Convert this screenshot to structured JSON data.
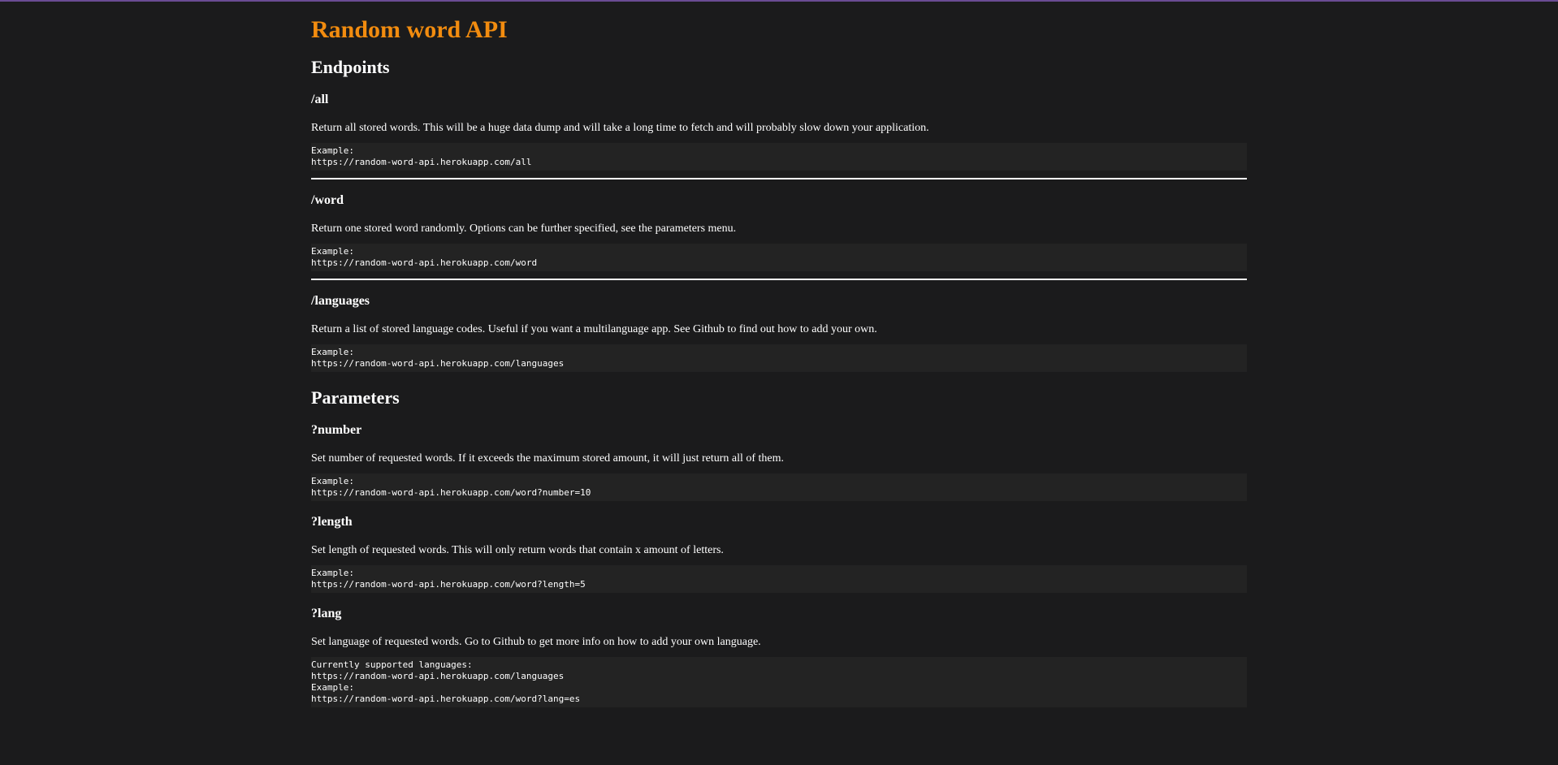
{
  "page": {
    "title": "Random word API"
  },
  "endpoints": {
    "heading": "Endpoints",
    "items": [
      {
        "name": "/all",
        "description": "Return all stored words. This will be a huge data dump and will take a long time to fetch and will probably slow down your application.",
        "example_label": "Example:",
        "example_url": "https://random-word-api.herokuapp.com/all"
      },
      {
        "name": "/word",
        "description": "Return one stored word randomly. Options can be further specified, see the parameters menu.",
        "example_label": "Example:",
        "example_url": "https://random-word-api.herokuapp.com/word"
      },
      {
        "name": "/languages",
        "description": "Return a list of stored language codes. Useful if you want a multilanguage app. See Github to find out how to add your own.",
        "example_label": "Example:",
        "example_url": "https://random-word-api.herokuapp.com/languages"
      }
    ]
  },
  "parameters": {
    "heading": "Parameters",
    "items": [
      {
        "name": "?number",
        "description": "Set number of requested words. If it exceeds the maximum stored amount, it will just return all of them.",
        "example_label": "Example:",
        "example_url": "https://random-word-api.herokuapp.com/word?number=10"
      },
      {
        "name": "?length",
        "description": "Set length of requested words. This will only return words that contain x amount of letters.",
        "example_label": "Example:",
        "example_url": "https://random-word-api.herokuapp.com/word?length=5"
      },
      {
        "name": "?lang",
        "description": "Set language of requested words. Go to Github to get more info on how to add your own language.",
        "supported_label": "Currently supported languages:",
        "supported_url": "https://random-word-api.herokuapp.com/languages",
        "example_label": "Example:",
        "example_url": "https://random-word-api.herokuapp.com/word?lang=es"
      }
    ]
  },
  "colors": {
    "background": "#1b1b1c",
    "accent": "#f28c0f",
    "code_background": "#232323",
    "text": "#ffffff"
  }
}
